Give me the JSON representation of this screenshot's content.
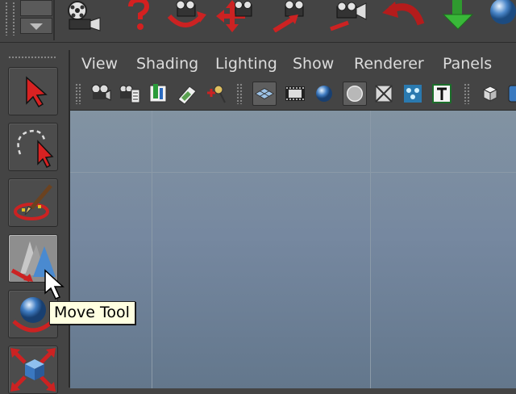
{
  "menu": {
    "items": [
      {
        "label": "View"
      },
      {
        "label": "Shading"
      },
      {
        "label": "Lighting"
      },
      {
        "label": "Show"
      },
      {
        "label": "Renderer"
      },
      {
        "label": "Panels"
      }
    ]
  },
  "toolbox": {
    "active_tool": "move-tool",
    "tooltip": "Move Tool"
  },
  "colors": {
    "ui_background": "#444444",
    "viewport_top": "#8293a2",
    "viewport_bottom": "#63778c",
    "tooltip_background": "#ffffe1",
    "accent_red": "#cc2222"
  },
  "icons": {
    "shelf": [
      "camera-film-icon",
      "help-question-icon",
      "camera-orbit-icon",
      "camera-track-icon",
      "camera-dolly-icon",
      "camera-zoom-icon",
      "red-undo-arrow-icon",
      "green-down-arrow-icon",
      "sphere-icon"
    ],
    "panel_toolbar": [
      "select-camera-icon",
      "camera-attributes-icon",
      "bookmark-icon",
      "image-plane-icon",
      "zoom-camera-icon",
      "grid-icon",
      "film-gate-icon",
      "smooth-shade-icon",
      "wireframe-on-shaded-icon",
      "xray-icon",
      "lighting-icon",
      "texture-icon",
      "isolate-cube-icon"
    ]
  }
}
